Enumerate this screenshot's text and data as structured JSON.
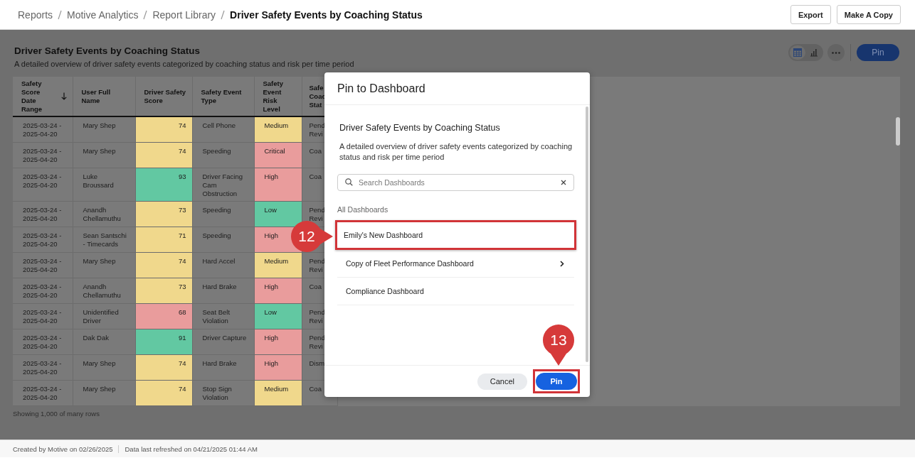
{
  "breadcrumb": [
    {
      "label": "Reports",
      "current": false
    },
    {
      "label": "Motive Analytics",
      "current": false
    },
    {
      "label": "Report Library",
      "current": false
    },
    {
      "label": "Driver Safety Events by Coaching Status",
      "current": true
    }
  ],
  "header_buttons": [
    "Export",
    "Make A Copy"
  ],
  "report": {
    "title": "Driver Safety Events by Coaching Status",
    "description": "A detailed overview of driver safety events categorized by coaching status and risk per time period"
  },
  "toolbar": {
    "views": [
      {
        "kind": "table",
        "selected": true
      },
      {
        "kind": "chart",
        "selected": false
      }
    ],
    "pin_button": "Pin"
  },
  "table": {
    "columns": [
      {
        "label": "Safety Score Date Range",
        "sorted": true
      },
      {
        "label": "User Full Name",
        "sorted": false
      },
      {
        "label": "Driver Safety Score",
        "sorted": false
      },
      {
        "label": "Safety Event Type",
        "sorted": false
      },
      {
        "label": "Safety Event Risk Level",
        "sorted": false
      },
      {
        "label": "Safe Coac Stat",
        "sorted": false
      }
    ],
    "rows": [
      {
        "date": "2025-03-24 - 2025-04-20",
        "name": "Mary Shep",
        "score": {
          "text": "74",
          "color": "#f0d88c"
        },
        "event": "Cell Phone",
        "risk": {
          "text": "Medium",
          "color": "#f0d88c"
        },
        "coaching": "Pend Revi"
      },
      {
        "date": "2025-03-24 - 2025-04-20",
        "name": "Mary Shep",
        "score": {
          "text": "74",
          "color": "#f0d88c"
        },
        "event": "Speeding",
        "risk": {
          "text": "Critical",
          "color": "#e99c9c"
        },
        "coaching": "Coa"
      },
      {
        "date": "2025-03-24 - 2025-04-20",
        "name": "Luke Broussard",
        "score": {
          "text": "93",
          "color": "#62c8a2"
        },
        "event": "Driver Facing Cam Obstruction",
        "risk": {
          "text": "High",
          "color": "#e99c9c"
        },
        "coaching": "Coa"
      },
      {
        "date": "2025-03-24 - 2025-04-20",
        "name": "Anandh Chellamuthu",
        "score": {
          "text": "73",
          "color": "#f0d88c"
        },
        "event": "Speeding",
        "risk": {
          "text": "Low",
          "color": "#62c8a2"
        },
        "coaching": "Pend Revi"
      },
      {
        "date": "2025-03-24 - 2025-04-20",
        "name": "Sean Santschi - Timecards",
        "score": {
          "text": "71",
          "color": "#f0d88c"
        },
        "event": "Speeding",
        "risk": {
          "text": "High",
          "color": "#e99c9c"
        }
      },
      {
        "date": "2025-03-24 - 2025-04-20",
        "name": "Mary Shep",
        "score": {
          "text": "74",
          "color": "#f0d88c"
        },
        "event": "Hard Accel",
        "risk": {
          "text": "Medium",
          "color": "#f0d88c"
        },
        "coaching": "Pend Revi"
      },
      {
        "date": "2025-03-24 - 2025-04-20",
        "name": "Anandh Chellamuthu",
        "score": {
          "text": "73",
          "color": "#f0d88c"
        },
        "event": "Hard Brake",
        "risk": {
          "text": "High",
          "color": "#e99c9c"
        },
        "coaching": "Coa"
      },
      {
        "date": "2025-03-24 - 2025-04-20",
        "name": "Unidentified Driver",
        "score": {
          "text": "68",
          "color": "#e99c9c"
        },
        "event": "Seat Belt Violation",
        "risk": {
          "text": "Low",
          "color": "#62c8a2"
        },
        "coaching": "Pend Revi"
      },
      {
        "date": "2025-03-24 - 2025-04-20",
        "name": "Dak Dak",
        "score": {
          "text": "91",
          "color": "#62c8a2"
        },
        "event": "Driver Capture",
        "risk": {
          "text": "High",
          "color": "#e99c9c"
        },
        "coaching": "Pend Revi"
      },
      {
        "date": "2025-03-24 - 2025-04-20",
        "name": "Mary Shep",
        "score": {
          "text": "74",
          "color": "#f0d88c"
        },
        "event": "Hard Brake",
        "risk": {
          "text": "High",
          "color": "#e99c9c"
        },
        "coaching": "Dism"
      },
      {
        "date": "2025-03-24 - 2025-04-20",
        "name": "Mary Shep",
        "score": {
          "text": "74",
          "color": "#f0d88c"
        },
        "event": "Stop Sign Violation",
        "risk": {
          "text": "Medium",
          "color": "#f0d88c"
        },
        "coaching": "Coa"
      }
    ],
    "row_count": "Showing 1,000 of many rows"
  },
  "footer": {
    "created": "Created by Motive on 02/26/2025",
    "refreshed": "Data last refreshed on 04/21/2025 01:44 AM"
  },
  "modal": {
    "title": "Pin to Dashboard",
    "report_title": "Driver Safety Events by Coaching Status",
    "report_description": "A detailed overview of driver safety events categorized by coaching status and risk per time period",
    "search": {
      "placeholder": "Search Dashboards"
    },
    "list_label": "All Dashboards",
    "dashboards": [
      {
        "label": "Emily's New Dashboard",
        "expandable": false,
        "highlighted": true
      },
      {
        "label": "Copy of Fleet Performance Dashboard",
        "expandable": true,
        "highlighted": false
      },
      {
        "label": "Compliance Dashboard",
        "expandable": false,
        "highlighted": false
      }
    ],
    "buttons": [
      {
        "kind": "cancel",
        "label": "Cancel",
        "highlighted": false
      },
      {
        "kind": "confirm",
        "label": "Pin",
        "highlighted": true
      }
    ]
  },
  "callouts": [
    {
      "number": "12",
      "kind": "right"
    },
    {
      "number": "13",
      "kind": "down"
    }
  ]
}
